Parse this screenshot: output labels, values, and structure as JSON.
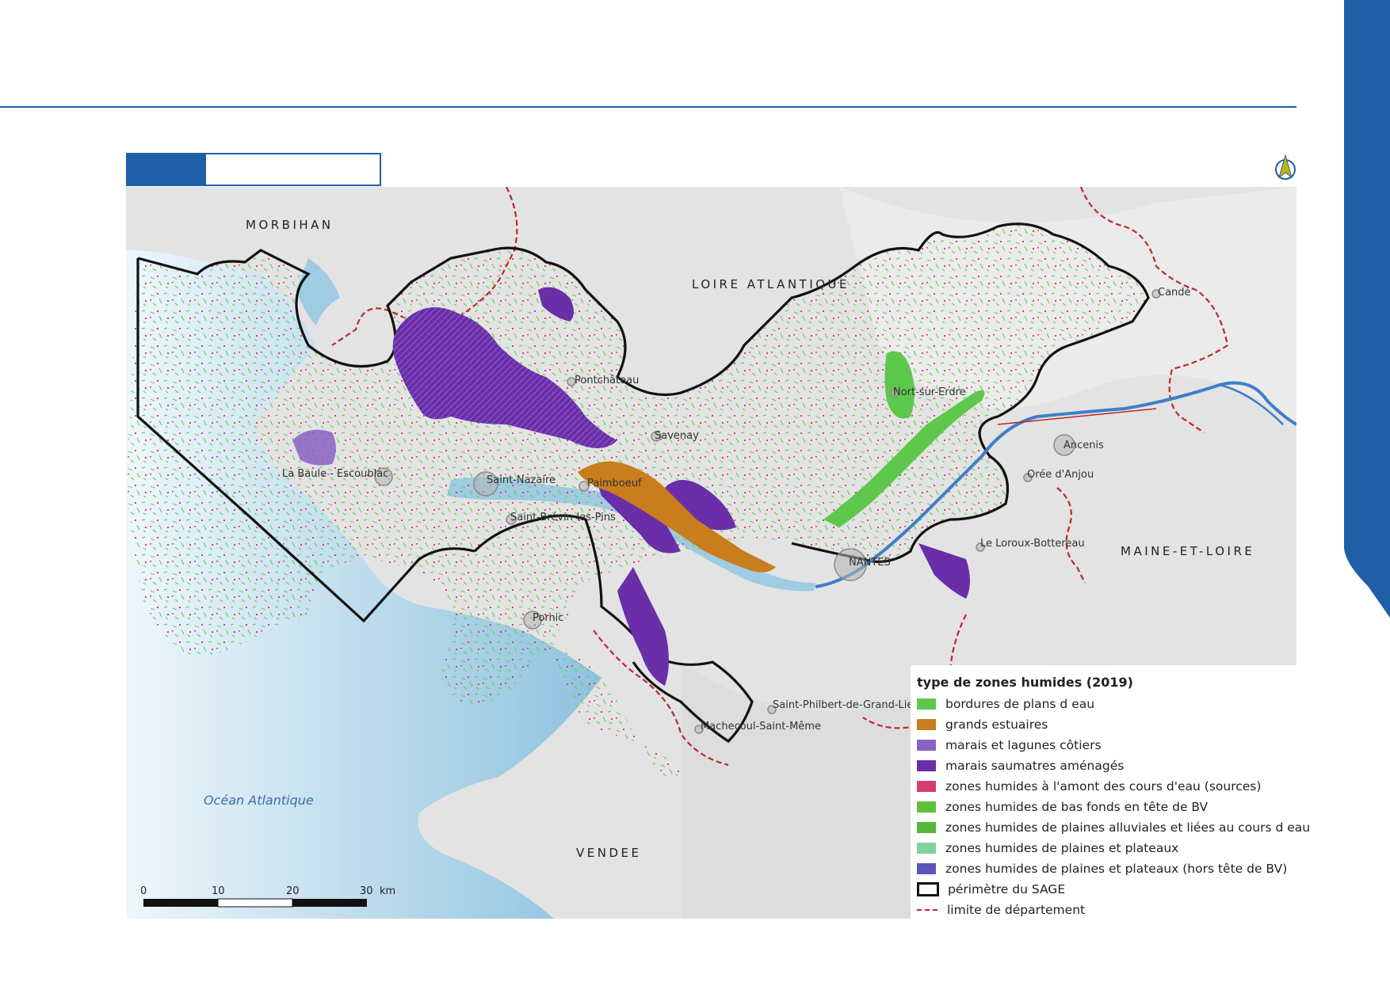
{
  "colors": {
    "accent": "#1f5fa8",
    "sea": "#9fcbe3",
    "bordures_plans_eau": "#5dc84b",
    "grands_estuaires": "#c97d1c",
    "marais_lagunes": "#8a62c6",
    "marais_saumatres": "#6a2ea8",
    "zones_amont": "#d83c72",
    "bas_fonds": "#5fc03e",
    "plaines_alluviales": "#56b83c",
    "plaines_plateaux": "#7fd3a0",
    "plaines_plateaux_hors": "#5a56bc",
    "perimetre": "#111111",
    "limite": "#c0262c",
    "river": "#3e7fc8"
  },
  "map": {
    "regions": {
      "morbihan": "MORBIHAN",
      "loire_atlantique": "LOIRE ATLANTIQUE",
      "maine_et_loire": "MAINE-ET-LOIRE",
      "vendee": "VENDEE",
      "ocean": "Océan Atlantique"
    },
    "cities": {
      "pontchateau": "Pontchâteau",
      "savenay": "Savenay",
      "nort_sur_erdre": "Nort-sur-Erdre",
      "cande": "Candé",
      "ancenis": "Ancenis",
      "oree_anjou": "Orée d'Anjou",
      "la_baule": "La Baule - Escoublac",
      "saint_nazaire": "Saint-Nazaire",
      "paimboeuf": "Paimboeuf",
      "saint_brevin": "Saint-Brévin-les-Pins",
      "le_loroux": "Le Loroux-Bottereau",
      "nantes": "NANTES",
      "pornic": "Pornic",
      "saint_philbert": "Saint-Philbert-de-Grand-Lieu",
      "machecoul": "Machecoul-Saint-Même"
    },
    "scale": {
      "ticks": [
        "0",
        "10",
        "20",
        "30"
      ],
      "unit": "km"
    }
  },
  "legend": {
    "title": "type de zones humides (2019)",
    "items": [
      {
        "label": "bordures de plans d eau",
        "color": "#5dc84b"
      },
      {
        "label": "grands estuaires",
        "color": "#c97d1c"
      },
      {
        "label": "marais et lagunes côtiers",
        "color": "#8a62c6"
      },
      {
        "label": "marais saumatres aménagés",
        "color": "#6a2ea8"
      },
      {
        "label": "zones humides à l'amont des cours d'eau (sources)",
        "color": "#d83c72"
      },
      {
        "label": "zones humides de bas fonds en tête de BV",
        "color": "#5fc03e"
      },
      {
        "label": "zones humides de plaines alluviales et liées au cours d eau",
        "color": "#56b83c"
      },
      {
        "label": "zones humides de plaines et plateaux",
        "color": "#7fd3a0"
      },
      {
        "label": "zones humides de plaines et plateaux (hors tête de BV)",
        "color": "#5a56bc"
      }
    ],
    "perimetre": "périmètre du SAGE",
    "limite": "limite de département"
  }
}
